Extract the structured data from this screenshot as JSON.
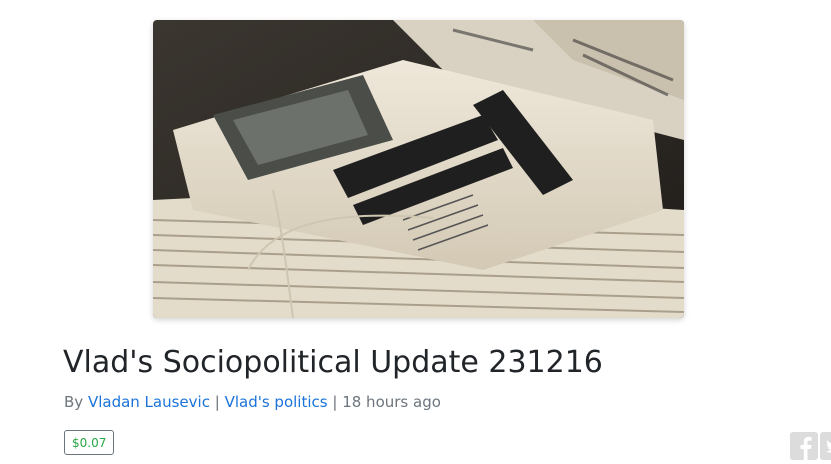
{
  "post": {
    "hero_image": "newspaper-stack-photo",
    "title": "Vlad's Sociopolitical Update 231216",
    "by_prefix": "By",
    "author": "Vladan Lausevic",
    "separator": "|",
    "community": "Vlad's politics",
    "time_ago": "18 hours ago",
    "payout": "$0.07"
  },
  "share": {
    "icons": [
      "facebook-icon",
      "twitter-icon"
    ],
    "color": "#dcdcdc"
  },
  "colors": {
    "link": "#1a73d9",
    "meta": "#6c757d",
    "payout_text": "#28a745"
  }
}
